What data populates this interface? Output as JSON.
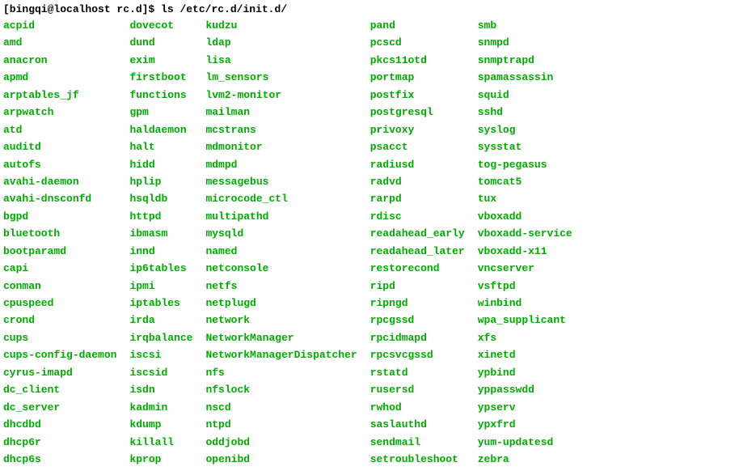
{
  "prompt": {
    "user_host": "[bingqi@localhost rc.d]$ ",
    "command": "ls /etc/rc.d/init.d/"
  },
  "columns": [
    [
      "acpid",
      "amd",
      "anacron",
      "apmd",
      "arptables_jf",
      "arpwatch",
      "atd",
      "auditd",
      "autofs",
      "avahi-daemon",
      "avahi-dnsconfd",
      "bgpd",
      "bluetooth",
      "bootparamd",
      "capi",
      "conman",
      "cpuspeed",
      "crond",
      "cups",
      "cups-config-daemon",
      "cyrus-imapd",
      "dc_client",
      "dc_server",
      "dhcdbd",
      "dhcp6r",
      "dhcp6s"
    ],
    [
      "dovecot",
      "dund",
      "exim",
      "firstboot",
      "functions",
      "gpm",
      "haldaemon",
      "halt",
      "hidd",
      "hplip",
      "hsqldb",
      "httpd",
      "ibmasm",
      "innd",
      "ip6tables",
      "ipmi",
      "iptables",
      "irda",
      "irqbalance",
      "iscsi",
      "iscsid",
      "isdn",
      "kadmin",
      "kdump",
      "killall",
      "kprop"
    ],
    [
      "kudzu",
      "ldap",
      "lisa",
      "lm_sensors",
      "lvm2-monitor",
      "mailman",
      "mcstrans",
      "mdmonitor",
      "mdmpd",
      "messagebus",
      "microcode_ctl",
      "multipathd",
      "mysqld",
      "named",
      "netconsole",
      "netfs",
      "netplugd",
      "network",
      "NetworkManager",
      "NetworkManagerDispatcher",
      "nfs",
      "nfslock",
      "nscd",
      "ntpd",
      "oddjobd",
      "openibd"
    ],
    [
      "pand",
      "pcscd",
      "pkcs11otd",
      "portmap",
      "postfix",
      "postgresql",
      "privoxy",
      "psacct",
      "radiusd",
      "radvd",
      "rarpd",
      "rdisc",
      "readahead_early",
      "readahead_later",
      "restorecond",
      "ripd",
      "ripngd",
      "rpcgssd",
      "rpcidmapd",
      "rpcsvcgssd",
      "rstatd",
      "rusersd",
      "rwhod",
      "saslauthd",
      "sendmail",
      "setroubleshoot"
    ],
    [
      "smb",
      "snmpd",
      "snmptrapd",
      "spamassassin",
      "squid",
      "sshd",
      "syslog",
      "sysstat",
      "tog-pegasus",
      "tomcat5",
      "tux",
      "vboxadd",
      "vboxadd-service",
      "vboxadd-x11",
      "vncserver",
      "vsftpd",
      "winbind",
      "wpa_supplicant",
      "xfs",
      "xinetd",
      "ypbind",
      "yppasswdd",
      "ypserv",
      "ypxfrd",
      "yum-updatesd",
      "zebra"
    ]
  ]
}
